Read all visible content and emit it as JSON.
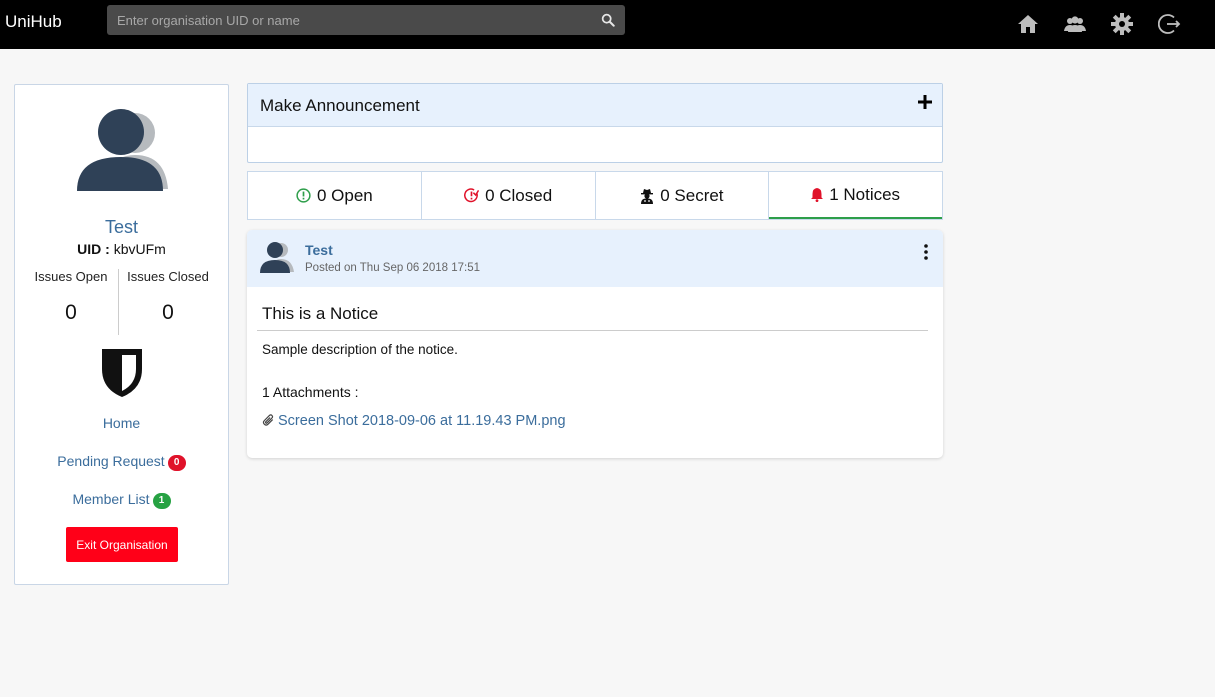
{
  "navbar": {
    "brand": "UniHub",
    "search": {
      "placeholder": "Enter organisation UID or name",
      "value": ""
    },
    "icons": [
      "home-icon",
      "members-icon",
      "gear-icon",
      "logout-icon"
    ]
  },
  "profile": {
    "name": "Test",
    "uid_label": "UID :",
    "uid": "kbvUFm",
    "issues_open_label": "Issues Open",
    "issues_open": "0",
    "issues_closed_label": "Issues Closed",
    "issues_closed": "0",
    "links": {
      "home": "Home",
      "pending_request": "Pending Request",
      "pending_request_count": "0",
      "member_list": "Member List",
      "member_list_count": "1"
    },
    "exit_label": "Exit Organisation"
  },
  "announcement": {
    "title": "Make Announcement"
  },
  "tabs": [
    {
      "label": "0 Open",
      "icon": "exclamation-circle-icon",
      "color": "#2e9e4a"
    },
    {
      "label": "0 Closed",
      "icon": "clock-closed-icon",
      "color": "#e0122a"
    },
    {
      "label": "0 Secret",
      "icon": "user-secret-icon",
      "color": "#111111"
    },
    {
      "label": "1 Notices",
      "icon": "bell-icon",
      "color": "#e0122a",
      "active": true
    }
  ],
  "notice": {
    "author": "Test",
    "posted": "Posted on Thu Sep 06 2018 17:51",
    "title": "This is a Notice",
    "description": "Sample description of the notice.",
    "attachments_label": "1 Attachments :",
    "attachment": "Screen Shot 2018-09-06 at 11.19.43 PM.png"
  },
  "colors": {
    "link": "#3b6d9c",
    "danger": "#ff0018",
    "success": "#27a243",
    "header_bg": "#e7f1fd",
    "avatar": "#2f4157"
  }
}
